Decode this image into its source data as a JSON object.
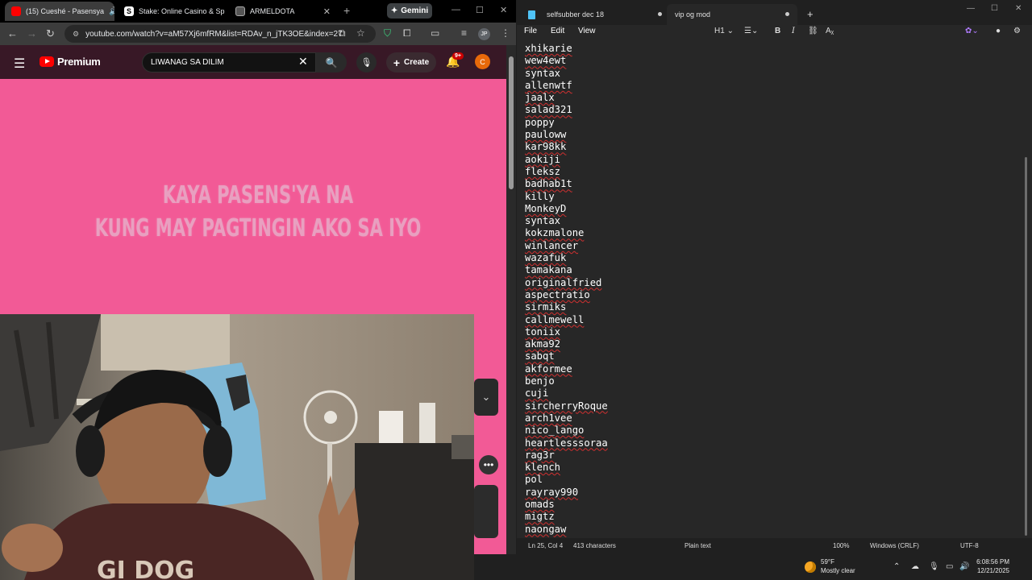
{
  "chrome": {
    "tabs": [
      {
        "label": "(15) Cueshé - Pasensya",
        "active": true
      },
      {
        "label": "Stake: Online Casino & Sp"
      },
      {
        "label": "ARMELDOTA"
      }
    ],
    "new_tab": "+",
    "gemini": "Gemini",
    "url": "youtube.com/watch?v=aM57Xj6mfRM&list=RDAv_n_jTK3OE&index=27",
    "profile": "JP"
  },
  "youtube": {
    "logo_text": "Premium",
    "search_value": "LIWANAG SA DILIM",
    "create_label": "Create",
    "notif_badge": "9+",
    "avatar_letter": "C",
    "lyric_line1": "KAYA PASENS'YA NA",
    "lyric_line2": "KUNG MAY PAGTINGIN AKO SA IYO"
  },
  "taskbar": {
    "temp": "59°F",
    "condition": "Mostly clear",
    "time": "6:08:56 PM",
    "date": "12/21/2025"
  },
  "notepad": {
    "tabs": [
      {
        "label": "selfsubber dec 18"
      },
      {
        "label": "vip og mod",
        "active": true
      }
    ],
    "menu": [
      "File",
      "Edit",
      "View"
    ],
    "heading_sel": "H1",
    "lines": [
      "xhikarie",
      "wew4ewt",
      "syntax",
      "allenwtf",
      "jaalx",
      "salad321",
      "poppy",
      "pauloww",
      "kar98kk",
      "aokiji",
      "fleksz",
      "badhab1t",
      "killy",
      "MonkeyD",
      "syntax",
      "kokzmalone",
      "winlancer",
      "wazafuk",
      "tamakana",
      "originalfried",
      "aspectratio",
      "sirmiks",
      "callmewell",
      "toniix",
      "akma92",
      "sabqt",
      "akformee",
      "benjo",
      "cuji",
      "sircherryRoque",
      "arch1vee",
      "nico_lango",
      "heartlesssoraa",
      "rag3r",
      "klench",
      "pol",
      "rayray990",
      "omads",
      "migtz",
      "naongaw"
    ],
    "status": {
      "position": "Ln 25, Col 4",
      "chars": "413 characters",
      "format": "Plain text",
      "zoom": "100%",
      "line_ending": "Windows (CRLF)",
      "encoding": "UTF-8"
    }
  }
}
